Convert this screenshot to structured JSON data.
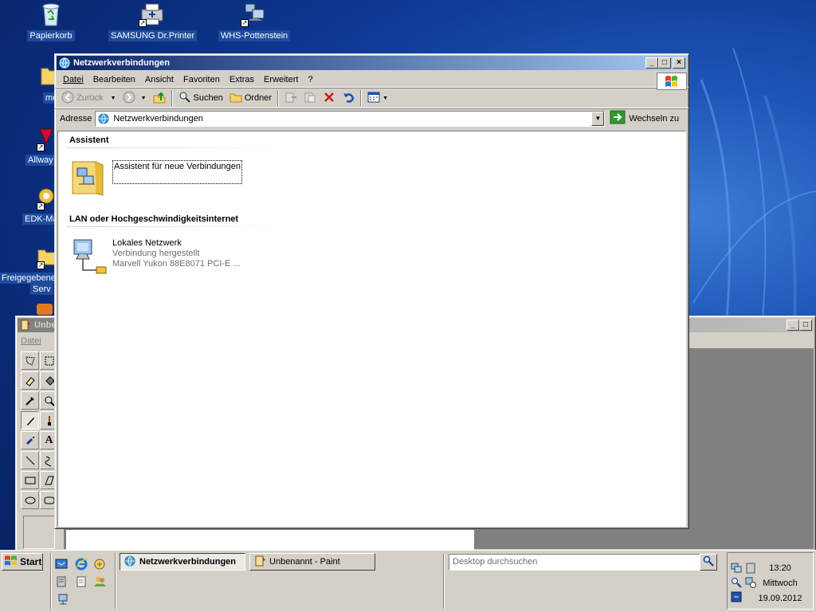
{
  "desktop": {
    "icons": [
      {
        "label": "Papierkorb"
      },
      {
        "label": "SAMSUNG Dr.Printer"
      },
      {
        "label": "WHS-Pottenstein"
      },
      {
        "label": "mo"
      },
      {
        "label": "Allway"
      },
      {
        "label": "EDK-Ma"
      },
      {
        "label": "Freigegebene"
      },
      {
        "label": "Serv"
      }
    ]
  },
  "explorer": {
    "title": "Netzwerkverbindungen",
    "controls": {
      "minimize": "_",
      "maximize": "□",
      "close": "×"
    },
    "menu": [
      "Datei",
      "Bearbeiten",
      "Ansicht",
      "Favoriten",
      "Extras",
      "Erweitert",
      "?"
    ],
    "toolbar": {
      "back": "Zurück",
      "search": "Suchen",
      "folders": "Ordner"
    },
    "address": {
      "label": "Adresse",
      "value": "Netzwerkverbindungen",
      "go": "Wechseln zu"
    },
    "groups": [
      {
        "header": "Assistent",
        "items": [
          {
            "name": "Assistent für neue Verbindungen"
          }
        ]
      },
      {
        "header": "LAN oder Hochgeschwindigkeitsinternet",
        "items": [
          {
            "name": "Lokales Netzwerk",
            "status": "Verbindung hergestellt",
            "device": "Marvell Yukon 88E8071 PCI-E ..."
          }
        ]
      }
    ]
  },
  "paint": {
    "title": "Unbe",
    "menu_first": "Datei"
  },
  "taskbar": {
    "start": "Start",
    "tasks": [
      {
        "label": "Netzwerkverbindungen"
      },
      {
        "label": "Unbenannt - Paint"
      }
    ],
    "search_placeholder": "Desktop durchsuchen",
    "clock": {
      "time": "13:20",
      "day": "Mittwoch",
      "date": "19.09.2012"
    }
  },
  "colors": {
    "title_active_start": "#0a246a",
    "title_active_end": "#a6caf0",
    "face": "#d4d0c8",
    "desktop": "#1d56b8"
  }
}
